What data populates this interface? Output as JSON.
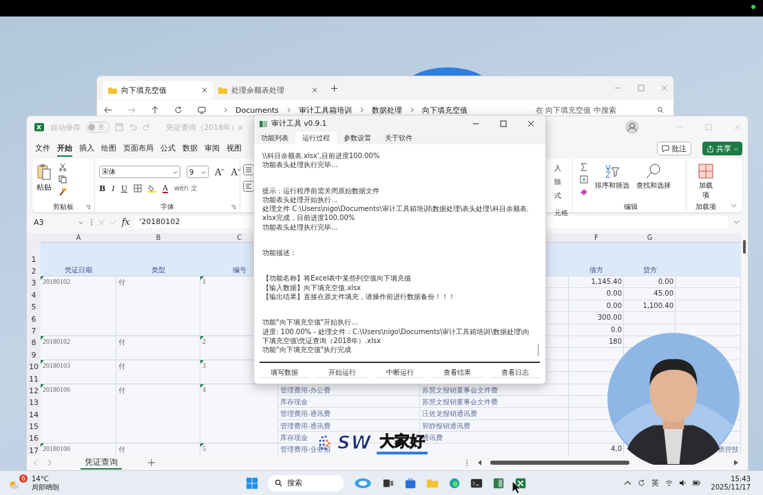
{
  "explorer": {
    "tabs": [
      {
        "label": "向下填充空值",
        "selected": true
      },
      {
        "label": "处理余额表处理",
        "selected": false
      }
    ],
    "breadcrumb": [
      "Documents",
      "审计工具箱培训",
      "数据处理",
      "向下填充空值"
    ],
    "search": {
      "placeholder": "在 向下填充空值 中搜索"
    }
  },
  "excel": {
    "autosave": {
      "label": "自动保存",
      "toggle": "关",
      "on": false
    },
    "title": "凭证查询（2018年）x",
    "menu": [
      {
        "label": "文件",
        "selected": false
      },
      {
        "label": "开始",
        "selected": true
      },
      {
        "label": "插入",
        "selected": false
      },
      {
        "label": "绘图",
        "selected": false
      },
      {
        "label": "页面布局",
        "selected": false
      },
      {
        "label": "公式",
        "selected": false
      },
      {
        "label": "数据",
        "selected": false
      },
      {
        "label": "审阅",
        "selected": false
      },
      {
        "label": "视图",
        "selected": false
      }
    ],
    "comment_button": "批注",
    "share_button": "共享",
    "ribbon": {
      "paste": "粘贴",
      "clipboard_group": "剪贴板",
      "font_name": "宋体",
      "font_size": "9",
      "grow_font": "A",
      "shrink_font": "A",
      "format_buttons": [
        "B",
        "I",
        "U"
      ],
      "font_color": "A",
      "phonetic": [
        "wén",
        "文"
      ],
      "font_group": "字体",
      "cells_partial": [
        "入",
        "除",
        "式"
      ],
      "cells_group_partial": "元格",
      "sort_filter": "排序和筛选",
      "find_select": "查找和选择",
      "editing_group": "编辑",
      "addins": "加载项",
      "addins_group": "加载项"
    },
    "name_box": "A3",
    "formula_label": "fx",
    "formula": "'20180102",
    "column_letters": [
      "A",
      "B",
      "C",
      "F",
      "G"
    ],
    "rows": [
      {
        "number": "1"
      },
      {
        "number": "2",
        "kind": "header",
        "cells": {
          "date": "凭证日期",
          "type": "类型",
          "voucher_no": "编号",
          "debit": "借方",
          "credit": "贷方"
        }
      },
      {
        "number": "3",
        "cells": {
          "date": "20180102",
          "type": "付",
          "voucher_no": "1",
          "debit": "1,145.40",
          "credit": "0.00"
        }
      },
      {
        "number": "4",
        "cells": {
          "debit": "0.00",
          "credit": "45.00"
        }
      },
      {
        "number": "5",
        "cells": {
          "debit": "0.00",
          "credit": "1,100.40"
        }
      },
      {
        "number": "6",
        "cells": {
          "debit": "300.00"
        }
      },
      {
        "number": "7",
        "cells": {
          "debit": "0.0"
        }
      },
      {
        "number": "8",
        "cells": {
          "date": "20180102",
          "type": "付",
          "voucher_no": "2",
          "debit": "180"
        }
      },
      {
        "number": "9"
      },
      {
        "number": "10",
        "cells": {
          "date": "20180103",
          "type": "付",
          "voucher_no": "3"
        }
      },
      {
        "number": "11"
      },
      {
        "number": "12",
        "cells": {
          "date": "20180106",
          "type": "付",
          "voucher_no": "4",
          "column_4": "管理费用-办公费",
          "column_5": "苏慧文报销董事会文件费"
        }
      },
      {
        "number": "13",
        "cells": {
          "column_4": "库存现金",
          "column_5": "苏慧文报销董事会文件费"
        }
      },
      {
        "number": "14",
        "cells": {
          "column_4": "管理费用-通讯费",
          "column_5": "汪佐龙报销通讯费"
        }
      },
      {
        "number": "15",
        "cells": {
          "column_4": "管理费用-通讯费",
          "column_5": "郭静报销通讯费"
        }
      },
      {
        "number": "16",
        "cells": {
          "column_4": "库存现金",
          "column_5": "通讯费"
        }
      },
      {
        "number": "17",
        "cells": {
          "date": "20180106",
          "type": "付",
          "voucher_no": "5",
          "column_4": "管理费用-业务招",
          "debit": "4,0",
          "column_8": "质控技"
        }
      }
    ],
    "sheet_tabs": [
      {
        "label": "凭证查询",
        "selected": true
      }
    ]
  },
  "dialog": {
    "title": "审计工具 v0.9.1",
    "tabs": [
      {
        "label": "功能列表",
        "selected": false
      },
      {
        "label": "运行过程",
        "selected": true
      },
      {
        "label": "参数设置",
        "selected": false
      },
      {
        "label": "关于软件",
        "selected": false
      }
    ],
    "log": [
      [
        "\\\\科目余额表.xlsx',目前进度100.00%",
        "功能表头处理执行完毕..."
      ],
      [
        "提示：运行程序前需关闭原始数据文件",
        "功能表头处理开始执行...",
        "处理文件 C:\\Users\\nigo\\Documents\\审计工具箱培训\\数据处理\\表头处理\\科目余额表.xlsx完成，目前进度100.00%",
        "功能表头处理执行完毕..."
      ],
      [
        "功能描述："
      ],
      [
        "【功能名称】将Excel表中某些列空值向下填充值",
        "【输入数据】向下填充空值.xlsx",
        "【输出结果】直接在原文件填充，请操作前进行数据备份！！！"
      ],
      [
        "功能\"向下填充空值\"开始执行...",
        "进度: 100.00% - 处理文件：C:\\Users\\nigo\\Documents\\审计工具箱培训\\数据处理\\向下填充空值\\凭证查询（2018年）.xlsx",
        "功能\"向下填充空值\"执行完成"
      ]
    ],
    "buttons": [
      "填写数据",
      "开始运行",
      "中断运行",
      "查看结果",
      "查看日志"
    ]
  },
  "caption": {
    "brand": "SW",
    "text": "大家好"
  },
  "taskbar": {
    "weather": {
      "badge": "6",
      "temperature": "14°C",
      "condition": "局部晴朗"
    },
    "search": {
      "placeholder": "搜索"
    },
    "input_method": "英",
    "time": "15:43",
    "date": "2025/11/17"
  }
}
